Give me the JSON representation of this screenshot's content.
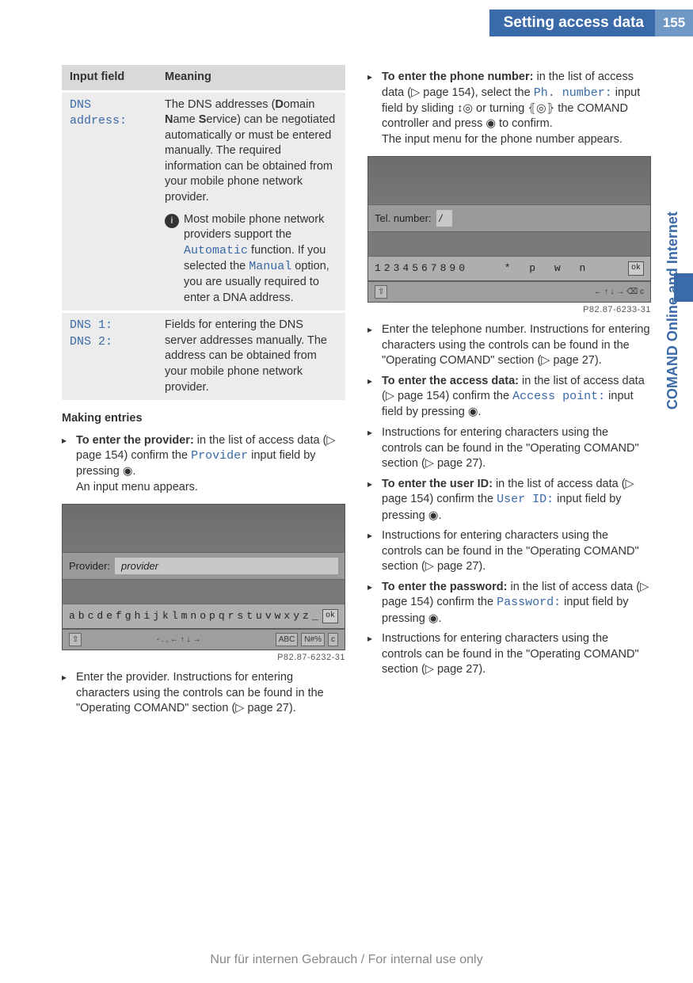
{
  "header": {
    "title": "Setting access data",
    "page": "155"
  },
  "side_label": "COMAND Online and Internet",
  "table": {
    "head1": "Input field",
    "head2": "Meaning",
    "row1_field": "DNS address:",
    "row1_text1": "The DNS addresses (",
    "row1_D": "D",
    "row1_omain": "omain ",
    "row1_N": "N",
    "row1_ame": "ame ",
    "row1_S": "S",
    "row1_ervice": "ervice) can be negotiated automatically or must be entered manually. The required information can be obtained from your mobile phone network provider.",
    "row1_note_a": "Most mobile phone network providers support the ",
    "row1_note_auto": "Automatic",
    "row1_note_b": " function. If you selected the ",
    "row1_note_manual": "Manual",
    "row1_note_c": " option, you are usually required to enter a DNA address.",
    "row2_field_a": "DNS 1:",
    "row2_field_b": "DNS 2:",
    "row2_text": "Fields for entering the DNS server addresses manually. The address can be obtained from your mobile phone network provider."
  },
  "left": {
    "subhead": "Making entries",
    "step1_bold": "To enter the provider:",
    "step1_a": " in the list of access data (▷ page 154) confirm the ",
    "step1_code": "Provider",
    "step1_b": " input field by pressing ",
    "step1_c": ".",
    "step1_line2": "An input menu appears.",
    "sc_label": "Provider:",
    "sc_value": "provider",
    "sc_chars": "abcdefghijklmnopqrstuvwxyz_",
    "sc_ok": "ok",
    "sc_sym": "⇧",
    "sc_bottom_mid": "- . , ← ↑ ↓ →",
    "sc_chip_abc": "ABC",
    "sc_chip_n": "N#%",
    "sc_chip_c": "c",
    "img1_id": "P82.87-6232-31",
    "step2": "Enter the provider. Instructions for entering characters using the controls can be found in the \"Operating COMAND\" section (▷ page 27)."
  },
  "right": {
    "step1_bold": "To enter the phone number:",
    "step1_a": " in the list of access data (▷ page 154), select the ",
    "step1_code": "Ph. number:",
    "step1_b": " input field by sliding ",
    "step1_c": " or turning ",
    "step1_d": " the COMAND controller and press ",
    "step1_e": " to confirm.",
    "step1_line2": "The input menu for the phone number appears.",
    "sc_label": "Tel. number:",
    "sc_value": "/",
    "sc_chars_a": "1234567890",
    "sc_chars_b": "* p w n",
    "sc_ok": "ok",
    "sc_bottom": "← ↑ ↓ → ⌫ c",
    "img2_id": "P82.87-6233-31",
    "step2": "Enter the telephone number. Instructions for entering characters using the controls can be found in the \"Operating COMAND\" section (▷ page 27).",
    "step3_bold": "To enter the access data:",
    "step3_a": " in the list of access data (▷ page 154) confirm the ",
    "step3_code": "Access point:",
    "step3_b": " input field by pressing ",
    "step3_c": ".",
    "step4": "Instructions for entering characters using the controls can be found in the \"Operating COMAND\" section (▷ page 27).",
    "step5_bold": "To enter the user ID:",
    "step5_a": " in the list of access data (▷ page 154) confirm the ",
    "step5_code": "User ID:",
    "step5_b": " input field by pressing ",
    "step5_c": ".",
    "step6": "Instructions for entering characters using the controls can be found in the \"Operating COMAND\" section (▷ page 27).",
    "step7_bold": "To enter the password:",
    "step7_a": " in the list of access data (▷ page 154) confirm the ",
    "step7_code": "Password:",
    "step7_b": " input field by pressing ",
    "step7_c": ".",
    "step8": "Instructions for entering characters using the controls can be found in the \"Operating COMAND\" section (▷ page 27)."
  },
  "glyphs": {
    "press": "◉",
    "slide": "↕◎",
    "turn_l": "⦃◎⦄"
  },
  "footer": "Nur für internen Gebrauch / For internal use only"
}
